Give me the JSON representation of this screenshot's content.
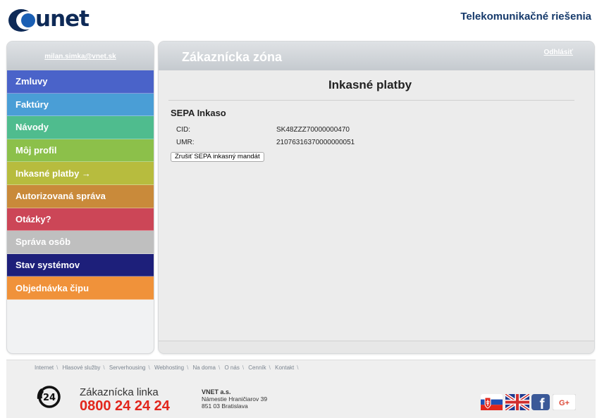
{
  "header": {
    "logo_text": "unet",
    "tagline": "Telekomunikačné riešenia"
  },
  "sidebar": {
    "user_email": "milan.simka@vnet.sk",
    "items": [
      {
        "label": "Zmluvy",
        "color": "#4a63c9"
      },
      {
        "label": "Faktúry",
        "color": "#4a9ed6"
      },
      {
        "label": "Návody",
        "color": "#4fbc8e"
      },
      {
        "label": "Môj profil",
        "color": "#8cc04a"
      },
      {
        "label": "Inkasné platby →",
        "color": "#b7bc3e"
      },
      {
        "label": "Autorizovaná správa",
        "color": "#c98a3a"
      },
      {
        "label": "Otázky?",
        "color": "#cc4657"
      },
      {
        "label": "Správa osôb",
        "color": "#bfbfbf"
      },
      {
        "label": "Stav systémov",
        "color": "#1d1f7a"
      },
      {
        "label": "Objednávka čipu",
        "color": "#f0923a"
      }
    ]
  },
  "main": {
    "zone_title": "Zákaznícka zóna",
    "logout_label": "Odhlásiť",
    "page_title": "Inkasné platby",
    "section_title": "SEPA Inkaso",
    "rows": [
      {
        "label": "CID:",
        "value": "SK48ZZZ70000000470"
      },
      {
        "label": "UMR:",
        "value": "21076316370000000051"
      }
    ],
    "cancel_button": "Zrušiť SEPA inkasný mandát"
  },
  "footer": {
    "links": [
      "Internet",
      "Hlasové služby",
      "Serverhousing",
      "Webhosting",
      "Na doma",
      "O nás",
      "Cenník",
      "Kontakt"
    ],
    "hotline_label": "Zákaznícka linka",
    "hotline_number": "0800 24 24 24",
    "phone_icon_text": "24",
    "company_name": "VNET a.s.",
    "company_street": "Námestie Hraničiarov 39",
    "company_city": "851 03 Bratislava",
    "social": [
      {
        "name": "slovak-flag-icon"
      },
      {
        "name": "uk-flag-icon"
      },
      {
        "name": "facebook-icon",
        "glyph": "f"
      },
      {
        "name": "google-plus-icon",
        "glyph": "G+"
      }
    ],
    "accent_red": "#e2261c"
  }
}
